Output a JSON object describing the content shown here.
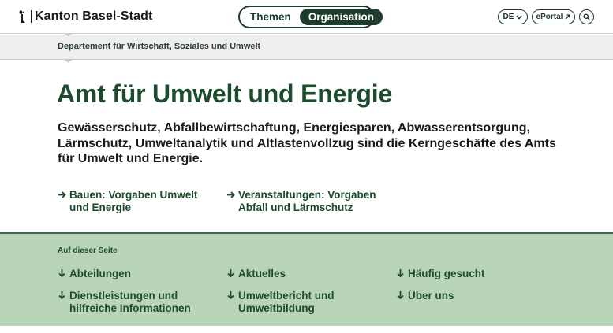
{
  "header": {
    "logo_text": "Kanton Basel-Stadt",
    "switch": {
      "themen_label": "Themen",
      "organisation_label": "Organisation",
      "active": "Organisation"
    },
    "language_label": "DE",
    "eportal_label": "ePortal",
    "search_aria": "Suche"
  },
  "breadcrumb": {
    "items": [
      {
        "label": "Departement für Wirtschaft, Soziales und Umwelt"
      }
    ]
  },
  "main": {
    "title": "Amt für Umwelt und Energie",
    "lead": "Gewässerschutz, Abfallbewirtschaftung, Energiesparen, Abwasserentsorgung, Lärmschutz, Umweltanalytik und Altlastenvollzug sind die Kerngeschäfte des Amts für Umwelt und Energie.",
    "quick_links": [
      {
        "label": "Bauen: Vorgaben Umwelt und Energie"
      },
      {
        "label": "Veranstaltungen: Vorgaben Abfall und Lärmschutz"
      }
    ]
  },
  "on_this_page": {
    "title": "Auf dieser Seite",
    "items": [
      {
        "label": "Abteilungen"
      },
      {
        "label": "Aktuelles"
      },
      {
        "label": "Häufig gesucht"
      },
      {
        "label": "Dienstleistungen und hilfreiche Informationen"
      },
      {
        "label": "Umweltbericht und Umweltbildung"
      },
      {
        "label": "Über uns"
      }
    ]
  },
  "colors": {
    "brand_green": "#1d4b2d",
    "dark_green": "#1d3c2c",
    "section_bg": "#b9d5b9",
    "breadcrumb_bg": "#eeeeee"
  }
}
